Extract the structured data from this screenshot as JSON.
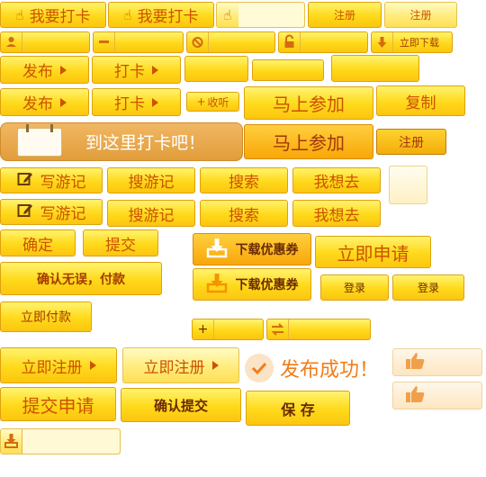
{
  "labels": {
    "wyd": "我要打卡",
    "zc": "注册",
    "ljxz": "立即下载",
    "fb": "发布",
    "dk": "打卡",
    "sq": "收听",
    "mscj": "马上参加",
    "fz": "复制",
    "dzldkb": "到这里打卡吧！",
    "xyj": "写游记",
    "syj": "搜游记",
    "ss": "搜索",
    "wxq": "我想去",
    "qd": "确定",
    "tj": "提交",
    "xzyhq": "下载优惠券",
    "ljsq": "立即申请",
    "qrwwfk": "确认无误，付款",
    "dl": "登录",
    "ljfk": "立即付款",
    "plus": "+",
    "ljzc": "立即注册",
    "fbcg": "发布成功！",
    "tjsq": "提交申请",
    "qrtj": "确认提交",
    "bc": "保 存"
  },
  "icons": {
    "hand": "pointing-hand",
    "user": "user",
    "minus": "minus",
    "forbid": "forbidden",
    "lock": "lock",
    "download": "download-arrow",
    "edit": "pencil-edit",
    "swap": "swap-arrows",
    "check": "check-circle",
    "thumb": "thumbs-up",
    "calendar": "calendar"
  },
  "colors": {
    "text": "#cc5200",
    "gold": "#ffd91a",
    "orange": "#f7a708",
    "success": "#f07d1a"
  }
}
